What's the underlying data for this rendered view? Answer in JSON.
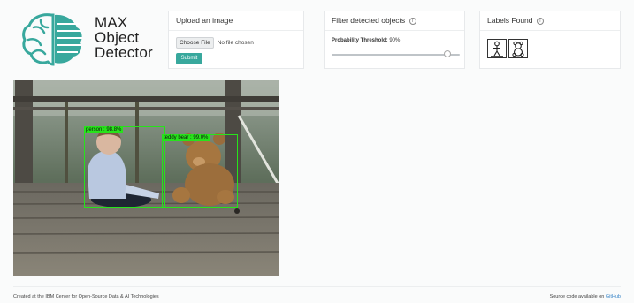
{
  "app": {
    "title_lines": [
      "MAX",
      "Object",
      "Detector"
    ]
  },
  "upload": {
    "heading": "Upload an image",
    "choose_file_label": "Choose File",
    "file_status": "No file chosen",
    "submit_label": "Submit"
  },
  "filter": {
    "heading": "Filter detected objects",
    "threshold_label": "Probability Threshold:",
    "threshold_value": "90%",
    "threshold_fraction": 0.9
  },
  "labels_found": {
    "heading": "Labels Found",
    "items": [
      {
        "icon": "person-icon"
      },
      {
        "icon": "teddy-bear-icon"
      }
    ]
  },
  "detections": [
    {
      "label": "person : 98.8%"
    },
    {
      "label": "teddy bear : 99.0%"
    }
  ],
  "footer": {
    "left_text": "Created at the IBM Center for Open-Source Data & AI Technologies",
    "right_text": "Source code available on",
    "right_link": "GitHub"
  },
  "colors": {
    "accent": "#38a89d",
    "box": "#27e31b",
    "link": "#3a86c8"
  }
}
